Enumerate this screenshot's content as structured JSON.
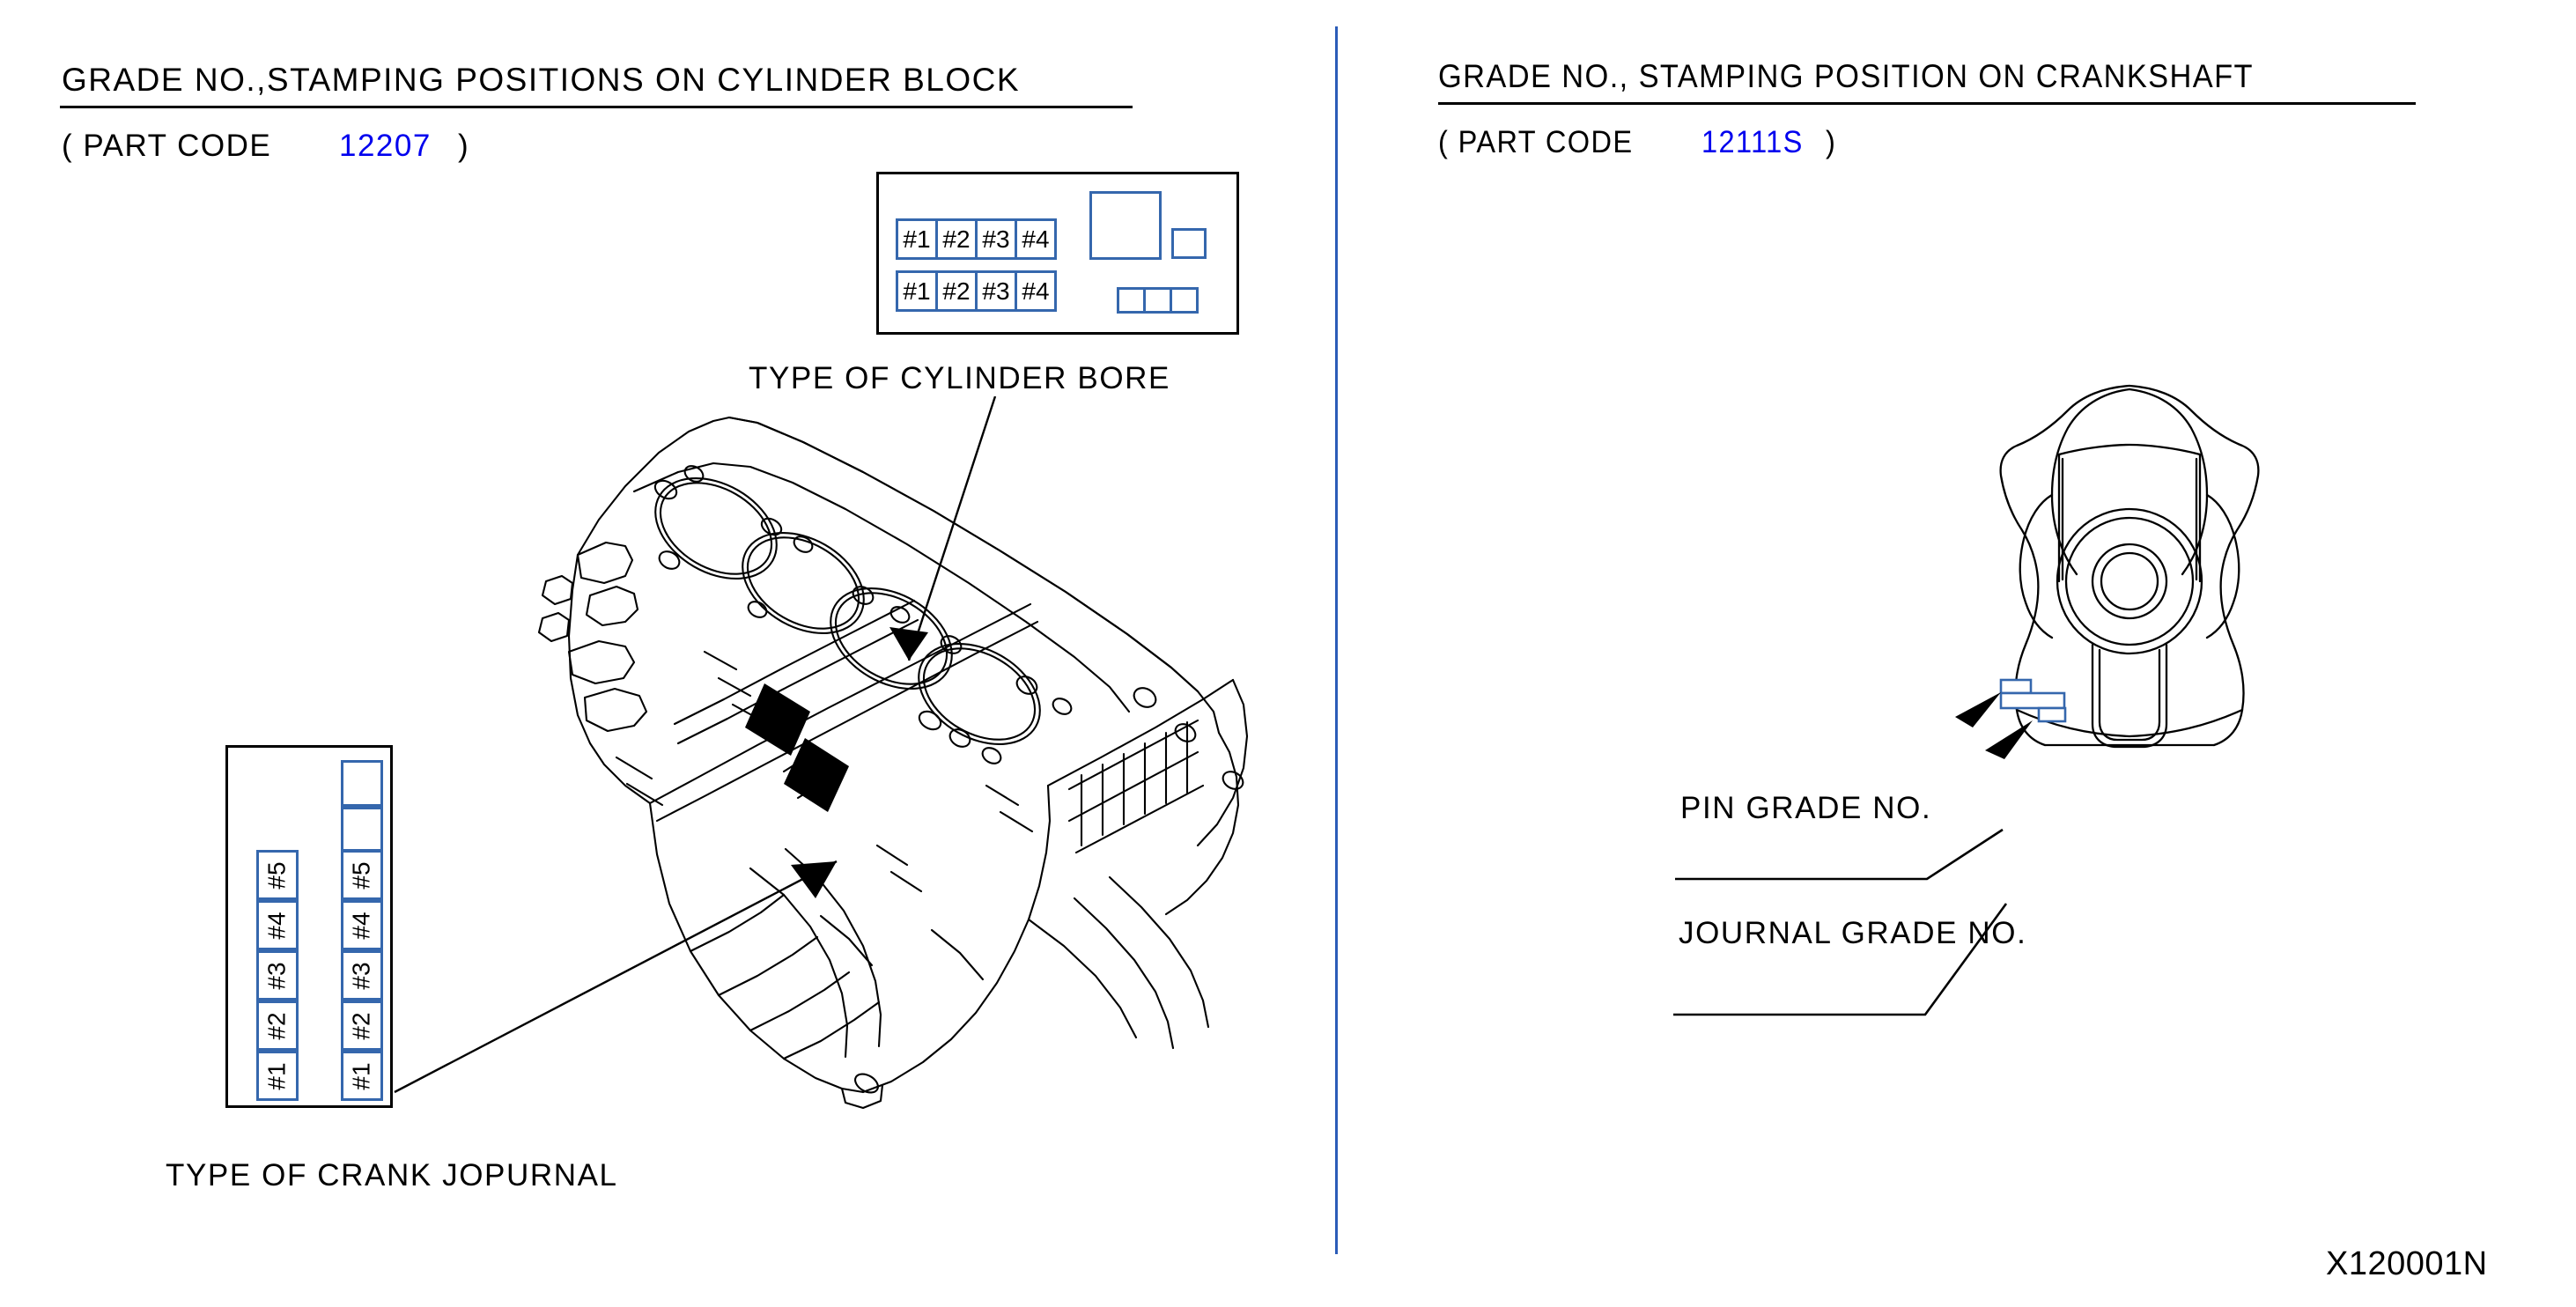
{
  "document": {
    "reference_code": "X120001N"
  },
  "left_panel": {
    "title": "GRADE  NO.,STAMPING  POSITIONS  ON  CYLINDER  BLOCK",
    "part_code_prefix": "( PART  CODE",
    "part_code": "12207",
    "part_code_suffix": ")",
    "bore_caption": "TYPE  OF  CYLINDER  BORE",
    "journal_caption": "TYPE  OF  CRANK  JOPURNAL",
    "bore_table": {
      "row1": [
        "#1",
        "#2",
        "#3",
        "#4"
      ],
      "row2": [
        "#1",
        "#2",
        "#3",
        "#4"
      ],
      "blank_large_box": "",
      "blank_small_box": "",
      "blank_triple_boxes": [
        "",
        "",
        ""
      ]
    },
    "journal_table": {
      "left_column": [
        "#1",
        "#2",
        "#3",
        "#4",
        "#5"
      ],
      "right_column": [
        "#1",
        "#2",
        "#3",
        "#4",
        "#5"
      ],
      "right_column_blanks": [
        "",
        ""
      ]
    },
    "illustration": "engine-cylinder-block"
  },
  "right_panel": {
    "title": "GRADE  NO.,  STAMPING  POSITION  ON  CRANKSHAFT",
    "part_code_prefix": "( PART  CODE",
    "part_code": "12111S",
    "part_code_suffix": ")",
    "labels": [
      {
        "text": "PIN  GRADE  NO."
      },
      {
        "text": "JOURNAL  GRADE  NO."
      }
    ],
    "illustration": "crankshaft-counterweight"
  },
  "colors": {
    "accent_blue": "#0000ee",
    "line_blue": "#3567ad",
    "divider_blue": "#2b5cb8",
    "ink_black": "#000000"
  }
}
